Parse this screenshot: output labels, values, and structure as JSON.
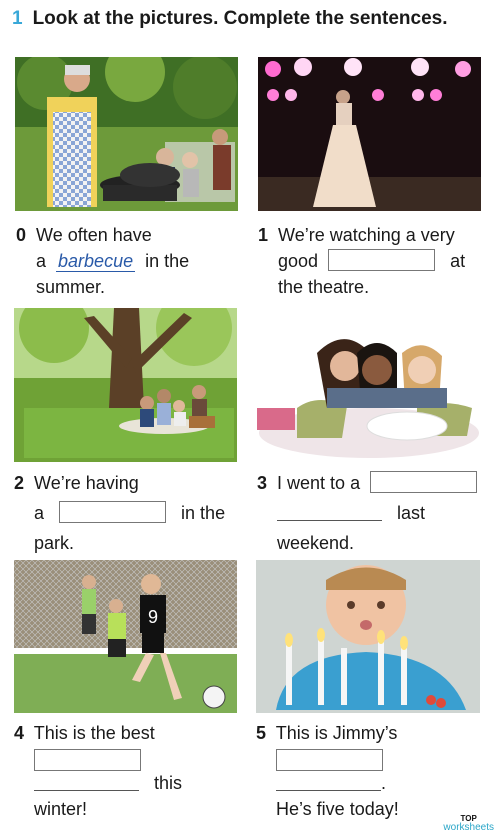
{
  "header": {
    "number": "1",
    "instruction": "Look at the pictures. Complete the sentences."
  },
  "items": [
    {
      "num": "0",
      "l1": "We often have",
      "l2a": "a",
      "answer": "barbecue",
      "l2b": "in the",
      "l3": "summer."
    },
    {
      "num": "1",
      "l1": "We’re watching a very",
      "l2a": "good",
      "l2b": "at",
      "l3": "the theatre."
    },
    {
      "num": "2",
      "l1": "We’re having",
      "l2a": "a",
      "l2b": "in the",
      "l3": "park."
    },
    {
      "num": "3",
      "l1a": "I went to a",
      "l2b": "last",
      "l3": "weekend."
    },
    {
      "num": "4",
      "l1": "This is the best",
      "l3b": "this",
      "l4": "winter!"
    },
    {
      "num": "5",
      "l1": "This is Jimmy’s",
      "l3b": ".",
      "l4": "He’s five today!"
    }
  ],
  "images": [
    {
      "icon": "barbecue-photo"
    },
    {
      "icon": "theatre-singer-photo"
    },
    {
      "icon": "picnic-park-photo"
    },
    {
      "icon": "sleepover-girls-photo"
    },
    {
      "icon": "football-match-photo"
    },
    {
      "icon": "birthday-cake-photo"
    }
  ],
  "logo": {
    "top": "TOP",
    "bottom": "worksheets"
  },
  "colors": {
    "accent": "#39a8d8",
    "answer": "#2a5aa8"
  }
}
